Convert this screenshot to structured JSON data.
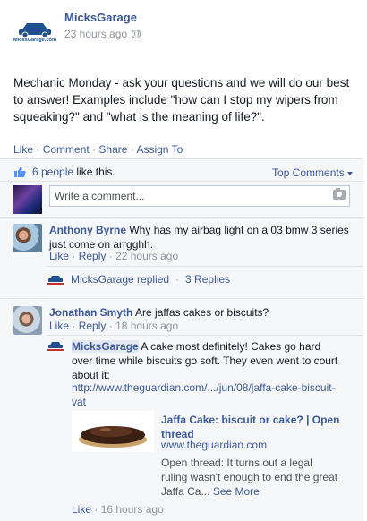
{
  "post": {
    "page_name": "MicksGarage",
    "time": "23 hours ago",
    "logo_text": "MicksGarage.com",
    "text": "Mechanic Monday - ask your questions and we will do our best to answer! Examples include \"how can I stop my wipers from squeaking?\" and \"what is the meaning of life?\"."
  },
  "actions": {
    "like": "Like",
    "comment": "Comment",
    "share": "Share",
    "assign": "Assign To",
    "separator": "·"
  },
  "likes": {
    "count_text": "6 people",
    "suffix": "like this."
  },
  "sort": {
    "label": "Top Comments"
  },
  "composer": {
    "placeholder": "Write a comment..."
  },
  "comments": [
    {
      "author": "Anthony Byrne",
      "text": "Why has my airbag light on a 03 bmw 3 series just come on arrgghh.",
      "like": "Like",
      "reply": "Reply",
      "time": "22 hours ago",
      "replied_by": "MicksGarage replied",
      "reply_count": "3 Replies"
    },
    {
      "author": "Jonathan Smyth",
      "text": "Are jaffas cakes or biscuits?",
      "like": "Like",
      "reply": "Reply",
      "time": "18 hours ago",
      "reply_item": {
        "author": "MicksGarage",
        "text": "A cake most definitely! Cakes go hard over time while biscuits go soft. They even went to court about it:",
        "url": "http://www.theguardian.com/.../jun/08/jaffa-cake-biscuit-vat",
        "attachment": {
          "title": "Jaffa Cake: biscuit or cake? | Open thread",
          "domain": "www.theguardian.com",
          "description": "Open thread: It turns out a legal ruling wasn't enough to end the great Jaffa Ca...",
          "see_more": "See More"
        },
        "like": "Like",
        "time": "16 hours ago"
      }
    }
  ]
}
